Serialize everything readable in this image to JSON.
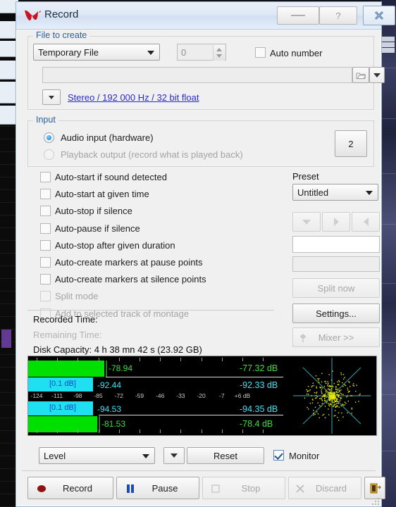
{
  "window": {
    "title": "Record",
    "logo_icon": "wavelab-w-icon",
    "minimize_label": "",
    "help_label": "?",
    "close_label": "✕",
    "minimize_icon": "minimize-icon",
    "help_icon": "help-icon",
    "close_icon": "close-icon"
  },
  "file_to_create": {
    "group_title": "File to create",
    "file_type": {
      "value": "Temporary File",
      "icon": "chevron-down-icon"
    },
    "number": {
      "value": "0",
      "spinner_icon": "spinner-arrows-icon"
    },
    "auto_number": {
      "label": "Auto number",
      "checked": false
    },
    "path": {
      "value": "",
      "placeholder": ""
    },
    "browse_icon": "folder-open-icon",
    "path_menu_icon": "chevron-down-icon",
    "format_menu_icon": "chevron-down-icon",
    "format_link": "Stereo / 192 000 Hz / 32 bit float"
  },
  "input": {
    "group_title": "Input",
    "options": [
      {
        "label": "Audio input (hardware)",
        "selected": true,
        "enabled": true
      },
      {
        "label": "Playback output (record what is played back)",
        "selected": false,
        "enabled": false
      }
    ],
    "channel_button": "2"
  },
  "options": {
    "items": [
      {
        "label": "Auto-start if sound detected",
        "checked": false,
        "enabled": true
      },
      {
        "label": "Auto-start at given time",
        "checked": false,
        "enabled": true
      },
      {
        "label": "Auto-stop if silence",
        "checked": false,
        "enabled": true
      },
      {
        "label": "Auto-pause if silence",
        "checked": false,
        "enabled": true
      },
      {
        "label": "Auto-stop after given duration",
        "checked": false,
        "enabled": true
      },
      {
        "label": "Auto-create markers at pause points",
        "checked": false,
        "enabled": true
      },
      {
        "label": "Auto-create markers at silence points",
        "checked": false,
        "enabled": true
      },
      {
        "label": "Split mode",
        "checked": false,
        "enabled": false
      },
      {
        "label": "Add to selected track of montage",
        "checked": false,
        "enabled": false
      }
    ]
  },
  "preset": {
    "label": "Preset",
    "value": "Untitled",
    "dropdown_icon": "chevron-down-icon",
    "buttons": [
      {
        "icon": "triangle-down-icon",
        "enabled": false
      },
      {
        "icon": "triangle-right-icon",
        "enabled": false
      },
      {
        "icon": "triangle-left-icon",
        "enabled": false
      }
    ],
    "field_white": "",
    "field_gray": "",
    "split_now": {
      "label": "Split now",
      "enabled": false
    },
    "settings": {
      "label": "Settings...",
      "enabled": true
    },
    "mixer": {
      "label": "Mixer >>",
      "enabled": false,
      "icon": "mixer-icon"
    }
  },
  "status": {
    "recorded_time_label": "Recorded Time:",
    "remaining_time_label": "Remaining Time:",
    "disk_capacity": "Disk Capacity: 4 h 38 mn 42 s (23.92 GB)"
  },
  "meter": {
    "scale_ticks": [
      "-124",
      "-111",
      "-98",
      "-85",
      "-72",
      "-59",
      "-46",
      "-33",
      "-20",
      "-7",
      "+6 dB"
    ],
    "scale_min": -124,
    "scale_max": 6,
    "rows": [
      {
        "kind": "peak",
        "channel": "left",
        "value": "-78.94",
        "readout": "-77.32 dB",
        "color": "#00e000",
        "tag": ""
      },
      {
        "kind": "rms",
        "channel": "left",
        "value": "-92.44",
        "readout": "-92.33 dB",
        "color": "#1ee0f0",
        "tag": "[0.1 dB]"
      },
      {
        "kind": "rms",
        "channel": "right",
        "value": "-94.53",
        "readout": "-94.35 dB",
        "color": "#1ee0f0",
        "tag": "[0.1 dB]"
      },
      {
        "kind": "peak",
        "channel": "right",
        "value": "-81.53",
        "readout": "-78.4 dB",
        "color": "#00e000",
        "tag": ""
      }
    ],
    "scope_label": "phase-scope"
  },
  "meter_controls": {
    "mode": {
      "value": "Level",
      "icon": "chevron-down-icon"
    },
    "menu_icon": "chevron-down-icon",
    "reset": "Reset",
    "monitor": {
      "label": "Monitor",
      "checked": true
    }
  },
  "transport": {
    "record": {
      "label": "Record",
      "icon": "record-dot-icon",
      "enabled": true
    },
    "pause": {
      "label": "Pause",
      "icon": "pause-bars-icon",
      "enabled": true
    },
    "stop": {
      "label": "Stop",
      "icon": "stop-square-icon",
      "enabled": false
    },
    "discard": {
      "label": "Discard",
      "icon": "x-icon",
      "enabled": false
    },
    "exit": {
      "label": "",
      "icon": "exit-door-icon",
      "enabled": true
    }
  },
  "colors": {
    "accent_link": "#2a2ad2",
    "group_title": "#2b5f9e",
    "peak_green": "#00e000",
    "rms_cyan": "#1ee0f0",
    "scope_dots": "#e8e800",
    "record_red": "#8e1414"
  }
}
